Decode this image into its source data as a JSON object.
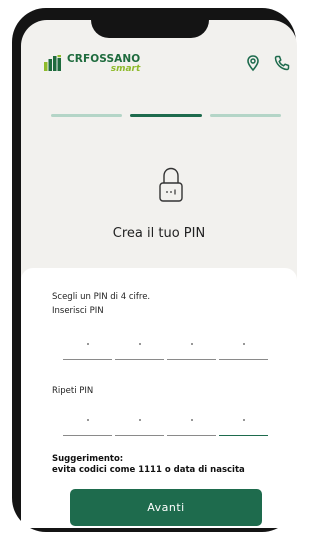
{
  "brand": {
    "name": "CRFOSSANO",
    "sub": "smart"
  },
  "header": {
    "icons": [
      "location-pin-icon",
      "phone-icon"
    ]
  },
  "progress": {
    "steps_total": 3,
    "current_step": 2
  },
  "page": {
    "title": "Crea il tuo PIN",
    "icon": "lock-icon"
  },
  "form": {
    "instruction": "Scegli un PIN di 4 cifre.",
    "pin_label": "Inserisci PIN",
    "repeat_label": "Ripeti PIN",
    "pin_slots": 4
  },
  "hint": {
    "title": "Suggerimento:",
    "text": "evita codici come 1111 o data di nascita"
  },
  "cta": {
    "label": "Avanti"
  },
  "colors": {
    "brand_green": "#1e6b4d",
    "lime": "#8fbb2c",
    "background": "#f2f1ee"
  }
}
